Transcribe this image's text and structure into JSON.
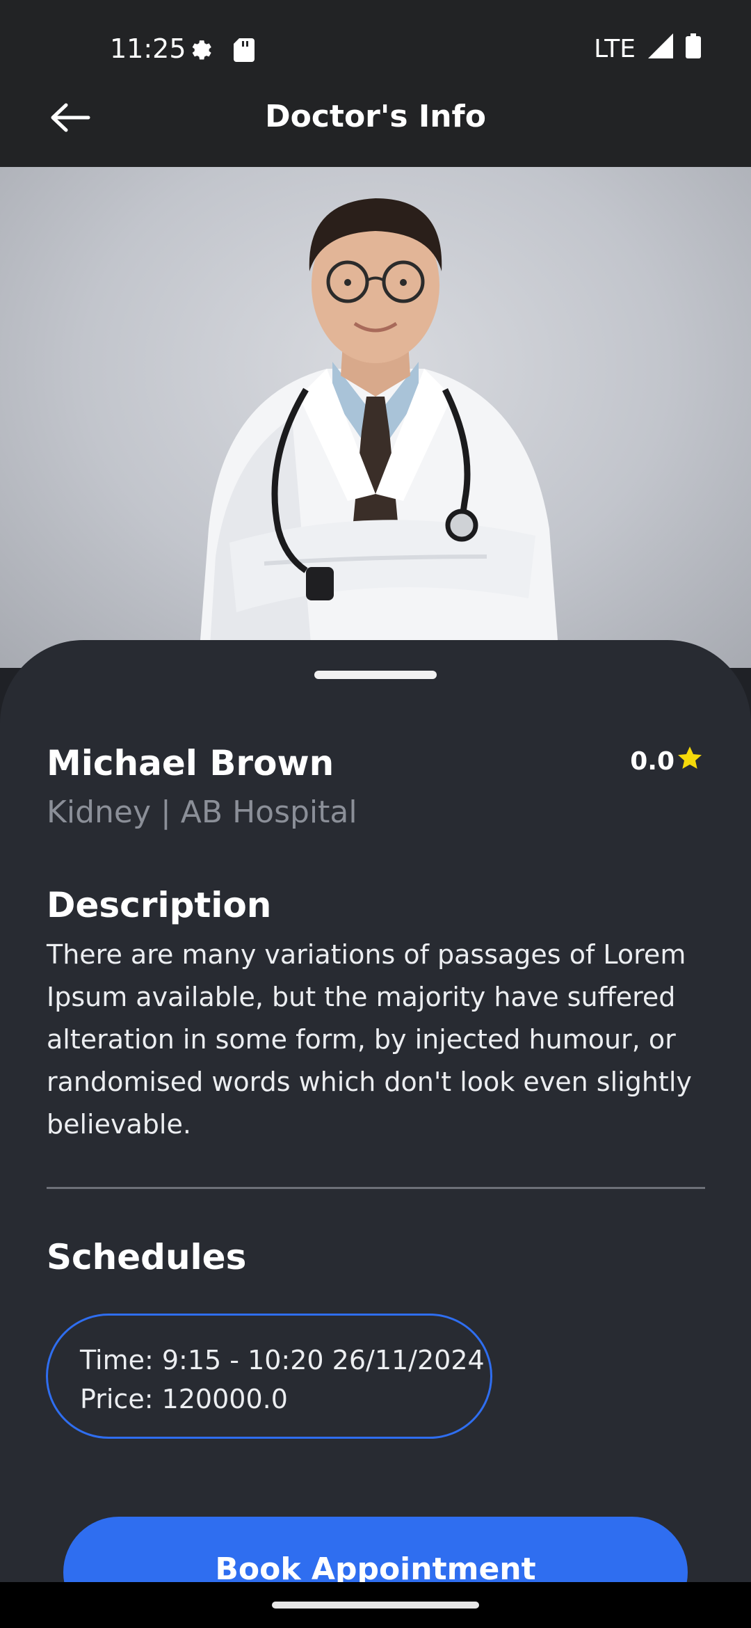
{
  "status_bar": {
    "time": "11:25",
    "network": "LTE",
    "icons": [
      "settings-gear-icon",
      "sd-card-icon",
      "signal-icon",
      "battery-icon"
    ]
  },
  "app_bar": {
    "title": "Doctor's Info",
    "back_icon": "arrow-left-icon"
  },
  "doctor": {
    "name": "Michael Brown",
    "subtitle": "Kidney | AB Hospital",
    "rating": "0.0",
    "rating_icon": "star-icon"
  },
  "description": {
    "title": "Description",
    "text": "There are many variations of passages of Lorem Ipsum available, but the majority have suffered alteration in some form, by injected humour, or randomised words which don't look even slightly believable."
  },
  "schedules": {
    "title": "Schedules",
    "items": [
      {
        "time": "Time: 9:15 - 10:20 26/11/2024",
        "price": "Price: 120000.0"
      }
    ]
  },
  "actions": {
    "book_label": "Book Appointment"
  },
  "colors": {
    "accent": "#2f6ef0",
    "sheet_bg": "#282b32",
    "star": "#f5d90a"
  }
}
